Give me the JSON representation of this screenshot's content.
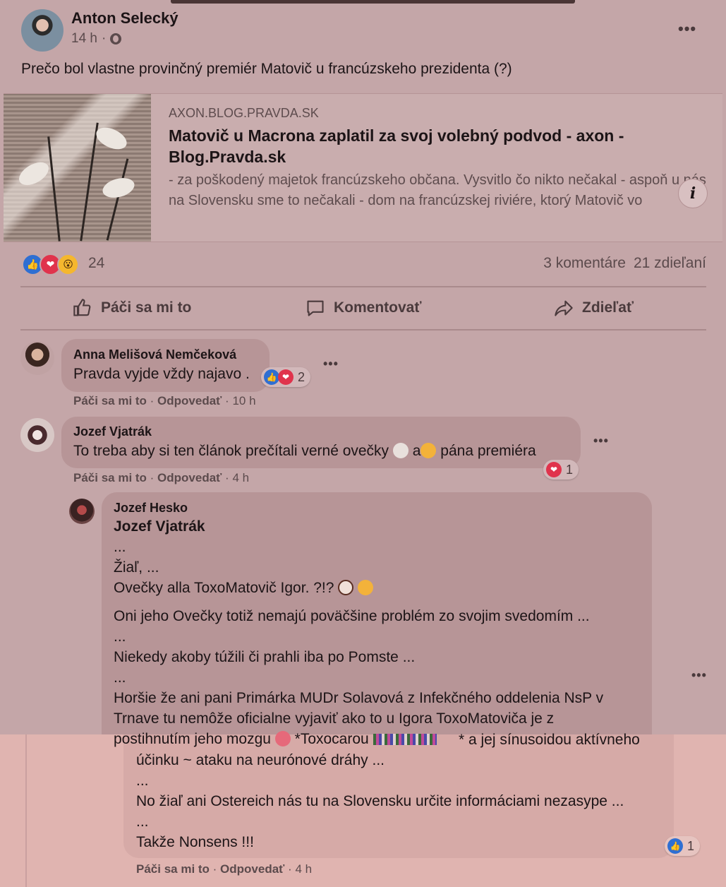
{
  "post": {
    "author": "Anton Selecký",
    "time": "14 h",
    "meta_sep": "·",
    "text": "Prečo bol vlastne provinčný premiér Matovič u francúzskeho prezidenta  (?)",
    "more": "•••"
  },
  "link": {
    "domain": "AXON.BLOG.PRAVDA.SK",
    "title": "Matovič u Macrona zaplatil za svoj volebný podvod - axon - Blog.Pravda.sk",
    "description": "- za poškodený majetok francúzskeho občana. Vysvitlo čo nikto nečakal - aspoň u nás na Slovensku sme to nečakali - dom na francúzskej riviére, ktorý Matovič vo",
    "info": "i"
  },
  "engagement": {
    "reaction_count": "24",
    "comments": "3 komentáre",
    "shares": "21 zdieľaní"
  },
  "actions": {
    "like": "Páči sa mi to",
    "comment": "Komentovať",
    "share": "Zdieľať"
  },
  "comments": [
    {
      "author": "Anna Melišová Nemčeková",
      "text": "Pravda vyjde vždy najavo .",
      "like": "Páči sa mi to",
      "reply": "Odpovedať",
      "time": "10 h",
      "reactions": "2"
    },
    {
      "author": "Jozef Vjatrák",
      "text_a": "To treba aby si ten článok prečítali verné ovečky",
      "text_b": "a",
      "text_c": "pána premiéra",
      "like": "Páči sa mi to",
      "reply": "Odpovedať",
      "time": "4 h",
      "reactions": "1"
    }
  ],
  "reply": {
    "author": "Jozef Hesko",
    "mention": "Jozef Vjatrák",
    "lines": [
      "...",
      "Žiaľ, ...",
      "Ovečky alla ToxoMatovič Igor. ?!?",
      "Oni jeho Ovečky totiž nemajú poväčšine problém zo svojim svedomím ...",
      "...",
      "Niekedy akoby túžili či prahli iba po Pomste ...",
      "...",
      "Horšie že ani pani Primárka MUDr Solavová z Infekčného oddelenia NsP v",
      "Trnave tu nemôže oficialne vyjaviť ako to u Igora ToxoMatoviča je z",
      "postihnutím jeho mozgu",
      "*Toxocarou",
      "* a jej sínusoidou aktívneho",
      "účinku ~ ataku na neurónové dráhy ...",
      "...",
      "No žiaľ ani Ostereich nás tu na Slovensku určite informáciami nezasype ...",
      "...",
      "Takže Nonsens !!!"
    ],
    "like": "Páči sa mi to",
    "reply": "Odpovedať",
    "time": "4 h",
    "reactions": "1"
  },
  "colors": {
    "like": "#2f6fd2",
    "love": "#e0334c",
    "wow": "#f5b72e"
  }
}
